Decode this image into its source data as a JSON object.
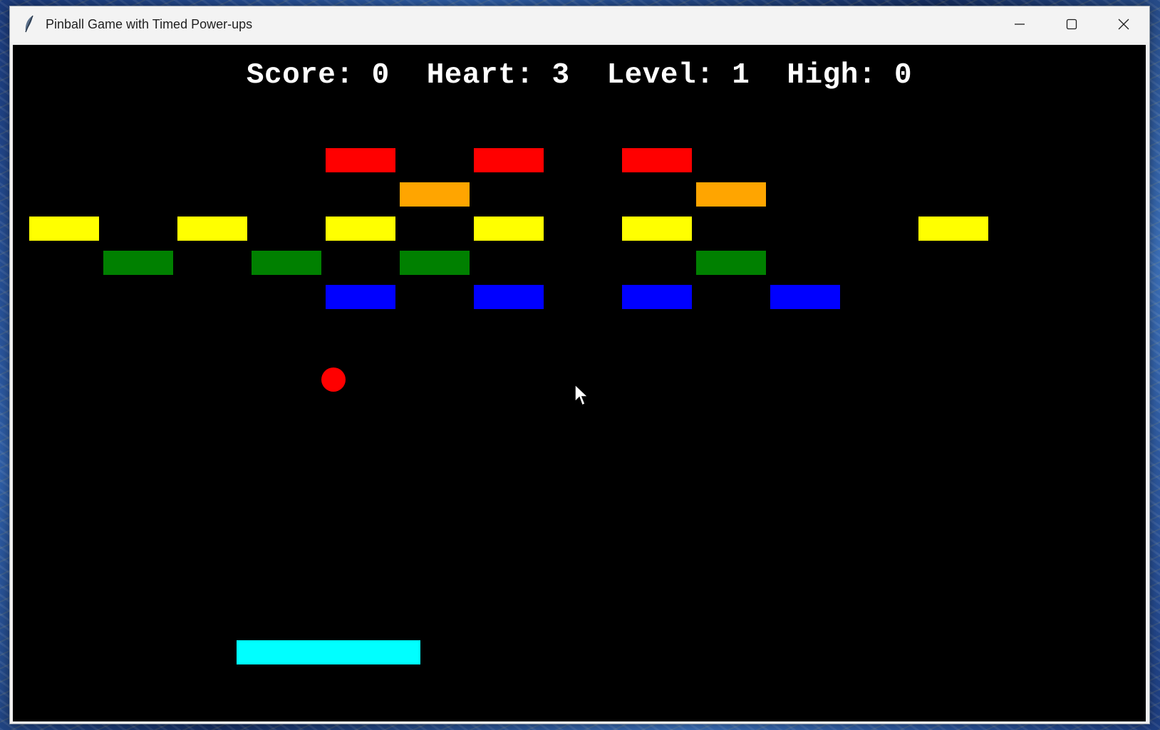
{
  "window": {
    "title": "Pinball Game with Timed Power-ups",
    "app_icon": "feather-icon",
    "controls": [
      "minimize-icon",
      "maximize-icon",
      "close-icon"
    ]
  },
  "hud": {
    "score_label": "Score:",
    "score_value": "0",
    "heart_label": "Heart:",
    "heart_value": "3",
    "level_label": "Level:",
    "level_value": "1",
    "high_label": "High:",
    "high_value": "0"
  },
  "colors": {
    "background": "#000000",
    "red": "#ff0000",
    "orange": "#ffa500",
    "yellow": "#ffff00",
    "green": "#008000",
    "blue": "#0000ff",
    "paddle": "#00ffff",
    "ball": "#ff0000",
    "text": "#ffffff"
  },
  "bricks": [
    {
      "row": 0,
      "col": 4,
      "color": "red"
    },
    {
      "row": 0,
      "col": 6,
      "color": "red"
    },
    {
      "row": 0,
      "col": 8,
      "color": "red"
    },
    {
      "row": 1,
      "col": 5,
      "color": "orange"
    },
    {
      "row": 1,
      "col": 9,
      "color": "orange"
    },
    {
      "row": 2,
      "col": 0,
      "color": "yellow"
    },
    {
      "row": 2,
      "col": 2,
      "color": "yellow"
    },
    {
      "row": 2,
      "col": 4,
      "color": "yellow"
    },
    {
      "row": 2,
      "col": 6,
      "color": "yellow"
    },
    {
      "row": 2,
      "col": 8,
      "color": "yellow"
    },
    {
      "row": 2,
      "col": 12,
      "color": "yellow"
    },
    {
      "row": 3,
      "col": 1,
      "color": "green"
    },
    {
      "row": 3,
      "col": 3,
      "color": "green"
    },
    {
      "row": 3,
      "col": 5,
      "color": "green"
    },
    {
      "row": 3,
      "col": 9,
      "color": "green"
    },
    {
      "row": 4,
      "col": 4,
      "color": "blue"
    },
    {
      "row": 4,
      "col": 6,
      "color": "blue"
    },
    {
      "row": 4,
      "col": 8,
      "color": "blue"
    },
    {
      "row": 4,
      "col": 10,
      "color": "blue"
    }
  ]
}
